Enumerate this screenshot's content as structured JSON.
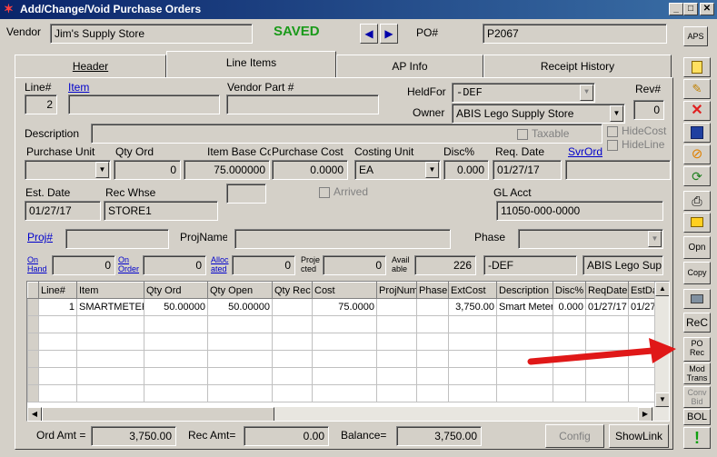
{
  "window": {
    "title": "Add/Change/Void Purchase Orders",
    "min": "_",
    "max": "□",
    "close": "✕"
  },
  "header": {
    "vendor_label": "Vendor",
    "vendor_value": "Jim's Supply Store",
    "status": "SAVED",
    "po_label": "PO#",
    "po_value": "P2067",
    "aps": "APS"
  },
  "tabs": [
    "Header",
    "Line Items",
    "AP Info",
    "Receipt History"
  ],
  "form": {
    "line_label": "Line#",
    "line_value": "2",
    "item_label": "Item",
    "vendor_part_label": "Vendor Part #",
    "heldfor_label": "HeldFor",
    "heldfor_value": "-DEF",
    "rev_label": "Rev#",
    "rev_value": "0",
    "owner_label": "Owner",
    "owner_value": "ABIS Lego Supply Store",
    "description_label": "Description",
    "taxable_label": "Taxable",
    "hidecost_label": "HideCost",
    "hideline_label": "HideLine",
    "purchase_unit_label": "Purchase Unit",
    "qty_ord_label": "Qty Ord",
    "qty_ord_value": "0",
    "item_base_label": "Item Base Co",
    "item_base_value": "75.000000",
    "purchase_cost_label": "Purchase Cost",
    "purchase_cost_value": "0.0000",
    "costing_unit_label": "Costing Unit",
    "costing_unit_value": "EA",
    "disc_label": "Disc%",
    "disc_value": "0.000",
    "req_date_label": "Req. Date",
    "req_date_value": "01/27/17",
    "svrord_label": "SvrOrd",
    "est_date_label": "Est. Date",
    "est_date_value": "01/27/17",
    "rec_whse_label": "Rec Whse",
    "rec_whse_value": "STORE1",
    "arrived_label": "Arrived",
    "glacct_label": "GL Acct",
    "glacct_value": "11050-000-0000",
    "proj_label": "Proj#",
    "projname_label": "ProjName",
    "phase_label": "Phase",
    "onhand_label1": "On",
    "onhand_label2": "Hand",
    "onhand_value": "0",
    "onorder_label1": "On",
    "onorder_label2": "Order",
    "onorder_value": "0",
    "alloc_label1": "Alloc",
    "alloc_label2": "ated",
    "alloc_value": "0",
    "projected_label1": "Proje",
    "projected_label2": "cted",
    "projected_value": "0",
    "avail_label1": "Avail",
    "avail_label2": "able",
    "avail_value": "226",
    "loc_value": "-DEF",
    "owner2_value": "ABIS Lego Sup"
  },
  "grid": {
    "columns": [
      "Line#",
      "Item",
      "Qty Ord",
      "Qty Open",
      "Qty Rec",
      "Cost",
      "ProjNum",
      "Phase",
      "ExtCost",
      "Description",
      "Disc%",
      "ReqDate",
      "EstDa"
    ],
    "rows": [
      [
        "1",
        "SMARTMETER",
        "50.00000",
        "50.00000",
        "",
        "75.0000",
        "",
        "",
        "3,750.00",
        "Smart Meter",
        "0.000",
        "01/27/17",
        "01/27"
      ]
    ]
  },
  "footer": {
    "ord_amt_label": "Ord Amt =",
    "ord_amt_value": "3,750.00",
    "rec_amt_label": "Rec Amt=",
    "rec_amt_value": "0.00",
    "balance_label": "Balance=",
    "balance_value": "3,750.00",
    "config": "Config",
    "showlink": "ShowLink"
  },
  "toolbar": {
    "opn": "Opn",
    "copy": "Copy",
    "rec": "ReC",
    "po_rec1": "PO",
    "po_rec2": "Rec",
    "mod1": "Mod",
    "mod2": "Trans",
    "conv1": "Conv",
    "conv2": "Bid",
    "bol": "BOL",
    "ok": "!"
  }
}
